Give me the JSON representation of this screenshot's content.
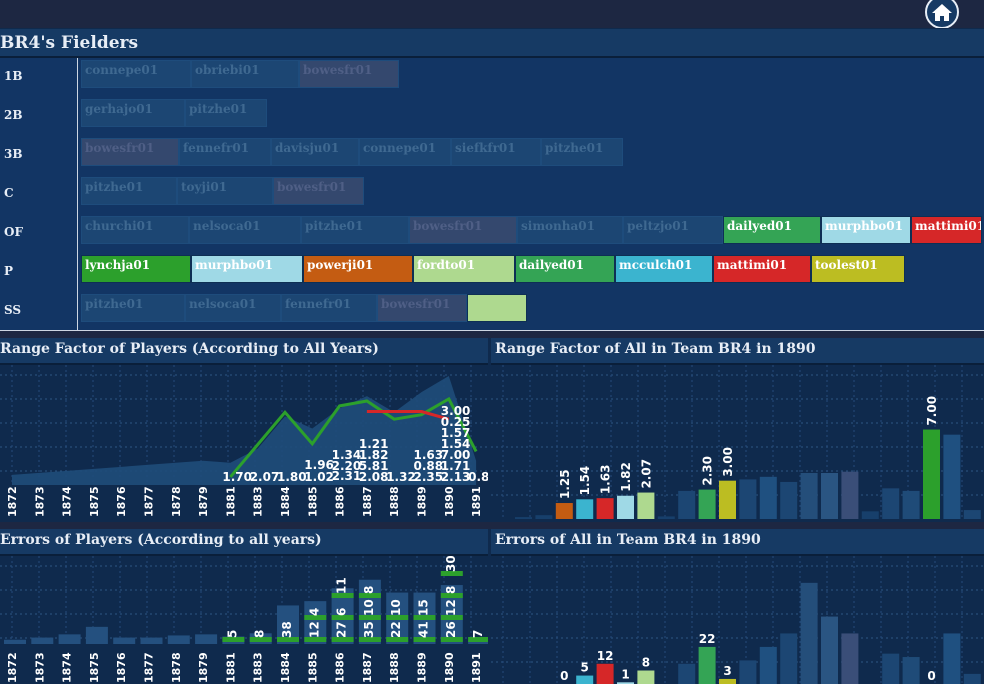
{
  "header": {
    "title": "BR4's Fielders",
    "home_icon": "home-icon"
  },
  "fielders": {
    "rows": [
      {
        "pos": "1B",
        "players": [
          {
            "name": "connepe01",
            "w": 110,
            "state": "dim"
          },
          {
            "name": "obriebi01",
            "w": 108,
            "state": "dim"
          },
          {
            "name": "bowesfr01",
            "w": 100,
            "state": "dim-purple"
          }
        ]
      },
      {
        "pos": "2B",
        "players": [
          {
            "name": "gerhajo01",
            "w": 104,
            "state": "dim"
          },
          {
            "name": "pitzhe01",
            "w": 82,
            "state": "dim"
          }
        ]
      },
      {
        "pos": "3B",
        "players": [
          {
            "name": "bowesfr01",
            "w": 98,
            "state": "dim-purple"
          },
          {
            "name": "fennefr01",
            "w": 92,
            "state": "dim"
          },
          {
            "name": "davisju01",
            "w": 88,
            "state": "dim"
          },
          {
            "name": "connepe01",
            "w": 92,
            "state": "dim"
          },
          {
            "name": "siefkfr01",
            "w": 90,
            "state": "dim"
          },
          {
            "name": "pitzhe01",
            "w": 82,
            "state": "dim"
          }
        ]
      },
      {
        "pos": "C",
        "players": [
          {
            "name": "pitzhe01",
            "w": 96,
            "state": "dim"
          },
          {
            "name": "toyji01",
            "w": 96,
            "state": "dim"
          },
          {
            "name": "bowesfr01",
            "w": 91,
            "state": "dim-purple"
          }
        ]
      },
      {
        "pos": "OF",
        "players": [
          {
            "name": "churchi01",
            "w": 108,
            "state": "dim"
          },
          {
            "name": "nelsoca01",
            "w": 112,
            "state": "dim"
          },
          {
            "name": "pitzhe01",
            "w": 108,
            "state": "dim"
          },
          {
            "name": "bowesfr01",
            "w": 108,
            "state": "dim-purple"
          },
          {
            "name": "simonha01",
            "w": 106,
            "state": "dim"
          },
          {
            "name": "peltzjo01",
            "w": 100,
            "state": "dim"
          },
          {
            "name": "dailyed01",
            "w": 98,
            "state": "#34a455"
          },
          {
            "name": "murphbo01",
            "w": 90,
            "state": "#9fd9e6"
          },
          {
            "name": "mattimi01",
            "w": 71,
            "state": "#d62728"
          }
        ]
      },
      {
        "pos": "P",
        "players": [
          {
            "name": "lynchja01",
            "w": 110,
            "state": "#2ca02c"
          },
          {
            "name": "murphbo01",
            "w": 112,
            "state": "#9fd9e6"
          },
          {
            "name": "powerji01",
            "w": 110,
            "state": "#c45c12"
          },
          {
            "name": "fordto01",
            "w": 102,
            "state": "#aed98f"
          },
          {
            "name": "dailyed01",
            "w": 100,
            "state": "#34a455"
          },
          {
            "name": "mcculch01",
            "w": 98,
            "state": "#3bb4cf"
          },
          {
            "name": "mattimi01",
            "w": 98,
            "state": "#d62728"
          },
          {
            "name": "toolest01",
            "w": 94,
            "state": "#bcbd22"
          }
        ]
      },
      {
        "pos": "SS",
        "players": [
          {
            "name": "pitzhe01",
            "w": 104,
            "state": "dim"
          },
          {
            "name": "nelsoca01",
            "w": 96,
            "state": "dim"
          },
          {
            "name": "fennefr01",
            "w": 96,
            "state": "dim"
          },
          {
            "name": "bowesfr01",
            "w": 90,
            "state": "dim-purple"
          },
          {
            "name": "",
            "w": 60,
            "state": "#aed98f"
          }
        ]
      }
    ]
  },
  "panels": {
    "rf_years_title": "Range Factor of Players (According to All Years)",
    "rf_team_title": "Range Factor of All in Team BR4 in 1890",
    "err_years_title": "Errors of Players (According to all years)",
    "err_team_title": "Errors of All in Team BR4 in 1890"
  },
  "chart_data": [
    {
      "type": "line",
      "title": "Range Factor of Players (According to All Years)",
      "categories": [
        "1872",
        "1873",
        "1874",
        "1875",
        "1876",
        "1877",
        "1878",
        "1879",
        "1881",
        "1883",
        "1884",
        "1885",
        "1886",
        "1887",
        "1888",
        "1889",
        "1890",
        "1891"
      ],
      "background_area": [
        0.25,
        0.3,
        0.35,
        0.4,
        0.45,
        0.5,
        0.55,
        0.6,
        0.55,
        0.9,
        1.7,
        1.4,
        1.9,
        2.2,
        1.8,
        2.3,
        2.7,
        0.6
      ],
      "series": [
        {
          "color": "#2ca02c",
          "values": [
            null,
            null,
            null,
            null,
            null,
            null,
            null,
            null,
            0.2,
            null,
            1.8,
            1.02,
            1.96,
            2.08,
            1.63,
            1.74,
            2.13,
            0.83
          ]
        },
        {
          "color": "#d62728",
          "values": [
            null,
            null,
            null,
            null,
            null,
            null,
            null,
            null,
            null,
            null,
            null,
            null,
            null,
            1.82,
            1.82,
            1.82,
            1.63,
            null
          ]
        }
      ],
      "labels": [
        {
          "cat": "1881",
          "text": "1.70"
        },
        {
          "cat": "1883",
          "text": "2.07"
        },
        {
          "cat": "1884",
          "text": "1.80"
        },
        {
          "cat": "1885",
          "text": "1.02"
        },
        {
          "cat": "1885",
          "text": "1.96",
          "dy": -1
        },
        {
          "cat": "1886",
          "text": "2.31",
          "dy": -1
        },
        {
          "cat": "1886",
          "text": "2.20"
        },
        {
          "cat": "1886",
          "text": "1.34"
        },
        {
          "cat": "1887",
          "text": "2.08"
        },
        {
          "cat": "1887",
          "text": "5.81"
        },
        {
          "cat": "1887",
          "text": "1.82"
        },
        {
          "cat": "1887",
          "text": "1.21"
        },
        {
          "cat": "1888",
          "text": "1.32"
        },
        {
          "cat": "1889",
          "text": "2.35"
        },
        {
          "cat": "1889",
          "text": "0.88"
        },
        {
          "cat": "1889",
          "text": "1.63"
        },
        {
          "cat": "1890",
          "text": "2.13"
        },
        {
          "cat": "1890",
          "text": "1.71"
        },
        {
          "cat": "1890",
          "text": "7.00"
        },
        {
          "cat": "1890",
          "text": "1.54"
        },
        {
          "cat": "1890",
          "text": "1.57"
        },
        {
          "cat": "1890",
          "text": "0.25"
        },
        {
          "cat": "1890",
          "text": "3.00"
        },
        {
          "cat": "1891",
          "text": "0.83"
        }
      ]
    },
    {
      "type": "bar",
      "title": "Range Factor of All in Team BR4 in 1890",
      "values": [
        0.15,
        0.3,
        1.25,
        1.54,
        1.63,
        1.82,
        2.07,
        0.2,
        2.2,
        2.3,
        3.0,
        3.1,
        3.3,
        2.9,
        3.6,
        3.6,
        3.7,
        0.6,
        2.4,
        2.2,
        7.0,
        6.6,
        0.7,
        8.2
      ],
      "colors": [
        "#173f6b",
        "#173f6b",
        "#c45c12",
        "#3bb4cf",
        "#d62728",
        "#9fd9e6",
        "#aed98f",
        "#173f6b",
        "#1c4673",
        "#34a455",
        "#bcbd22",
        "#1c4673",
        "#1f5080",
        "#1c4673",
        "#244e7a",
        "#2a5582",
        "#3a4e78",
        "#173f6b",
        "#1c4673",
        "#1f4b78",
        "#2ca02c",
        "#1f5080",
        "#1c4673",
        "#1f5384"
      ],
      "labels": [
        "",
        "",
        "1.25",
        "1.54",
        "1.63",
        "1.82",
        "2.07",
        "",
        "",
        "2.30",
        "3.00",
        "",
        "",
        "",
        "",
        "",
        "",
        "",
        "",
        "",
        "7.00",
        "",
        "",
        ""
      ],
      "ylim": [
        0,
        9
      ]
    },
    {
      "type": "bar",
      "title": "Errors of Players (According to all years)",
      "categories": [
        "1872",
        "1873",
        "1874",
        "1875",
        "1876",
        "1877",
        "1878",
        "1879",
        "1881",
        "1883",
        "1884",
        "1885",
        "1886",
        "1887",
        "1888",
        "1889",
        "1890",
        "1891"
      ],
      "values": [
        4,
        6,
        9,
        16,
        6,
        6,
        8,
        9,
        7,
        10,
        36,
        40,
        52,
        60,
        48,
        48,
        55,
        3
      ],
      "labels": [
        {
          "cat": "1881",
          "text": "5"
        },
        {
          "cat": "1883",
          "text": "8"
        },
        {
          "cat": "1884",
          "text": "38"
        },
        {
          "cat": "1885",
          "text": "12"
        },
        {
          "cat": "1885",
          "text": "4"
        },
        {
          "cat": "1886",
          "text": "27"
        },
        {
          "cat": "1886",
          "text": "6"
        },
        {
          "cat": "1886",
          "text": "11"
        },
        {
          "cat": "1887",
          "text": "35"
        },
        {
          "cat": "1887",
          "text": "10"
        },
        {
          "cat": "1887",
          "text": "8"
        },
        {
          "cat": "1888",
          "text": "22"
        },
        {
          "cat": "1888",
          "text": "10"
        },
        {
          "cat": "1889",
          "text": "41"
        },
        {
          "cat": "1889",
          "text": "15"
        },
        {
          "cat": "1890",
          "text": "26"
        },
        {
          "cat": "1890",
          "text": "12"
        },
        {
          "cat": "1890",
          "text": "8"
        },
        {
          "cat": "1890",
          "text": "30"
        },
        {
          "cat": "1891",
          "text": "7"
        }
      ],
      "ylim": [
        0,
        70
      ]
    },
    {
      "type": "bar",
      "title": "Errors of All in Team BR4 in 1890",
      "values": [
        0,
        0,
        0,
        5,
        12,
        1,
        8,
        0,
        12,
        22,
        3,
        14,
        22,
        30,
        60,
        40,
        30,
        0,
        18,
        16,
        0,
        30,
        6,
        55
      ],
      "colors": [
        "#173f6b",
        "#173f6b",
        "#173f6b",
        "#3bb4cf",
        "#d62728",
        "#9fd9e6",
        "#aed98f",
        "#173f6b",
        "#1c4673",
        "#34a455",
        "#bcbd22",
        "#1c4673",
        "#1f5080",
        "#1c4673",
        "#244e7a",
        "#2a5582",
        "#3a4e78",
        "#173f6b",
        "#1c4673",
        "#1f4b78",
        "#2ca02c",
        "#1f5080",
        "#1c4673",
        "#1f5384"
      ],
      "labels": [
        "",
        "",
        "0",
        "5",
        "12",
        "1",
        "8",
        "",
        "",
        "22",
        "3",
        "",
        "",
        "",
        "",
        "",
        "",
        "",
        "",
        "",
        "0",
        "",
        "",
        ""
      ],
      "ylim": [
        0,
        70
      ]
    }
  ]
}
